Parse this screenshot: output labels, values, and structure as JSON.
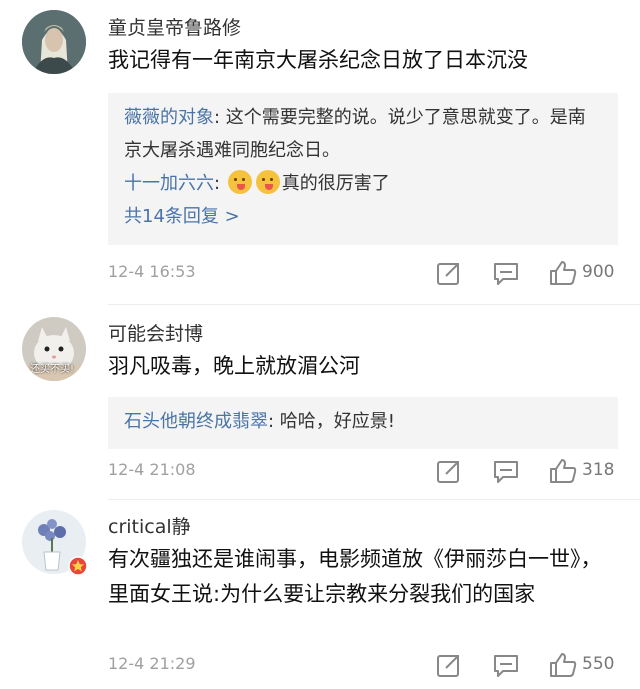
{
  "comments": [
    {
      "username": "童贞皇帝鲁路修",
      "avatar": "elf-warrior-avatar",
      "text": "我记得有一年南京大屠杀纪念日放了日本沉没",
      "replies": [
        {
          "name": "薇薇的对象",
          "sep": ": ",
          "text": "这个需要完整的说。说少了意思就变了。是南京大屠杀遇难同胞纪念日。"
        },
        {
          "name": "十一加六六",
          "sep": ": ",
          "text": "真的很厉害了",
          "emojis": [
            "drooling-face-emoji",
            "drooling-face-emoji"
          ]
        }
      ],
      "more": "共14条回复 >",
      "timestamp": "12-4 16:53",
      "likes": "900"
    },
    {
      "username": "可能会封博",
      "avatar": "cat-avatar",
      "avatar_caption": "还买不买!",
      "text": "羽凡吸毒，晚上就放湄公河",
      "replies": [
        {
          "name": "石头他朝终成翡翠",
          "sep": ": ",
          "text": "哈哈，好应景!"
        }
      ],
      "timestamp": "12-4 21:08",
      "likes": "318"
    },
    {
      "username": "critical静",
      "avatar": "flower-vase-avatar",
      "text": "有次疆独还是谁闹事，电影频道放《伊丽莎白一世》，里面女王说:为什么要让宗教来分裂我们的国家",
      "timestamp": "12-4 21:29",
      "likes": "550"
    }
  ],
  "icons": {
    "share": "share-icon",
    "comment": "comment-icon",
    "like": "thumbs-up-icon"
  },
  "colors": {
    "reply_name": "#4a74a8",
    "reply_bg": "#f4f4f4",
    "meta_gray": "#a0a0a0"
  }
}
